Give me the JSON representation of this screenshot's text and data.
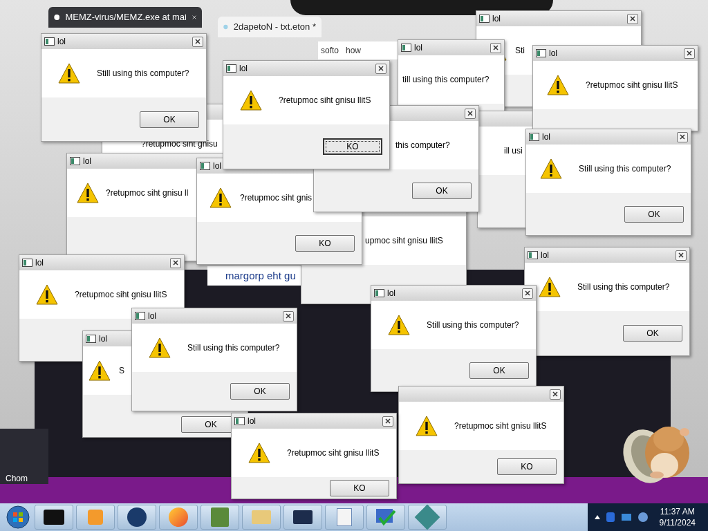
{
  "browser": {
    "tabs": [
      {
        "label": "MEMZ-virus/MEMZ.exe at mai",
        "selected": true
      },
      {
        "label": "2dapetoN - txt.eton *",
        "selected": false
      }
    ],
    "bookmarks": [
      "softo",
      "how"
    ],
    "page_text": "margorp eht gu"
  },
  "desktop_label": "Chom",
  "dialogs": [
    {
      "title": "lol",
      "message": "Sti"
    },
    {
      "title": "lol",
      "message": "till using this computer?"
    },
    {
      "message": "ill usi"
    },
    {
      "title": "lol",
      "message": "?retupmoc siht gnisu llitS"
    },
    {
      "title": "lol",
      "message": "Still using this computer?",
      "button": "OK",
      "focused": false
    },
    {
      "title": "lol",
      "message": "Still using this computer?",
      "button": "OK",
      "focused": false
    },
    {
      "message": "upmoc siht gnisu llitS"
    },
    {
      "message": "?retupmoc siht gnisu"
    },
    {
      "title": "lol",
      "message": "?retupmoc siht gnisu ll"
    },
    {
      "title": "lol",
      "message": "?retupmoc siht gnis",
      "button": "KO",
      "focused": false
    },
    {
      "message": "this computer?",
      "button": "OK",
      "focused": false
    },
    {
      "title": "lol",
      "message": "Still using this computer?",
      "button": "OK",
      "focused": false
    },
    {
      "title": "lol",
      "message": "?retupmoc siht gnisu llitS"
    },
    {
      "title": "lol",
      "message": "S",
      "button": "OK",
      "focused": false
    },
    {
      "title": "lol",
      "message": "Still using this computer?",
      "button": "OK",
      "focused": false
    },
    {
      "title": "lol",
      "message": "Still using this computer?",
      "button": "OK",
      "focused": false
    },
    {
      "message": "?retupmoc siht gnisu llitS",
      "button": "KO",
      "focused": false
    },
    {
      "title": "lol",
      "message": "?retupmoc siht gnisu llitS",
      "button": "KO",
      "focused": true
    },
    {
      "title": "lol",
      "message": "?retupmoc siht gnisu llitS",
      "button": "KO",
      "focused": false
    }
  ],
  "taskbar": {
    "time": "11:37 AM",
    "date": "9/11/2024"
  }
}
